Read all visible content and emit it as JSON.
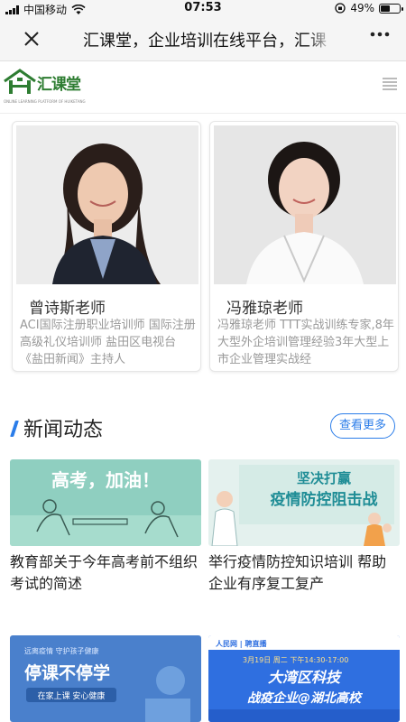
{
  "status_bar": {
    "carrier": "中国移动",
    "time": "07:53",
    "battery": "49%",
    "battery_level": 0.49
  },
  "nav": {
    "close_icon": "close-icon",
    "title": "汇课堂，企业培训在线平台，汇课",
    "more_icon": "more-dots-icon"
  },
  "header": {
    "logo_text": "汇课堂",
    "logo_subtext": "ONLINE LEARNING PLATFORM OF HUIKETANG",
    "menu_icon": "menu-icon"
  },
  "teachers": [
    {
      "name": "曾诗斯老师",
      "description": "ACI国际注册职业培训师 国际注册高级礼仪培训师 盐田区电视台《盐田新闻》主持人"
    },
    {
      "name": "冯雅琼老师",
      "description": "冯雅琼老师 TTT实战训练专家,8年大型外企培训管理经验3年大型上市企业管理实战经"
    }
  ],
  "news": {
    "title": "新闻动态",
    "more_label": "查看更多",
    "items": [
      {
        "image_text": "高考，加油！",
        "caption": "教育部关于今年高考前不组织考试的简述"
      },
      {
        "image_text_1": "坚决打赢",
        "image_text_2": "疫情防控阻击战",
        "caption": "举行疫情防控知识培训 帮助企业有序复工复产"
      },
      {
        "image_top": "远离疫情 守护孩子健康",
        "image_main": "停课不停学",
        "image_sub": "在家上课 安心健康"
      },
      {
        "image_top": "3月19日 周二 下午14:30-17:00",
        "image_main_1": "大湾区科技",
        "image_main_2": "战疫企业@湖北高校"
      }
    ]
  },
  "colors": {
    "accent": "#2b7de9",
    "logo_green": "#2e7d32",
    "muted_text": "#999999"
  }
}
